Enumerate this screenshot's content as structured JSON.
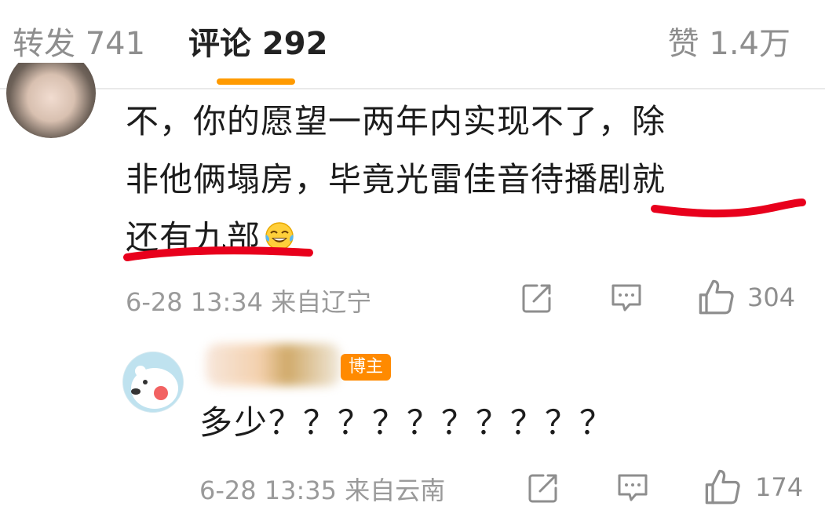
{
  "tabs": {
    "repost": "转发 741",
    "comments": "评论 292",
    "likes": "赞 1.4万"
  },
  "colors": {
    "accent": "#ff9a00",
    "highlight_marker": "#e8001c",
    "badge": "#ff8a00",
    "muted_text": "#9a9a9a"
  },
  "comment1": {
    "lines": [
      "不，你的愿望一两年内实现不了，除",
      "非他俩塌房，毕竟光雷佳音待播剧就",
      "还有九部"
    ],
    "emoji": "laughing-tears-icon",
    "meta": "6-28 13:34 来自辽宁",
    "like_count": "304"
  },
  "comment2": {
    "badge": "博主",
    "text": "多少？？？？？？？？？？",
    "meta": "6-28 13:35 来自云南",
    "like_count": "174"
  }
}
